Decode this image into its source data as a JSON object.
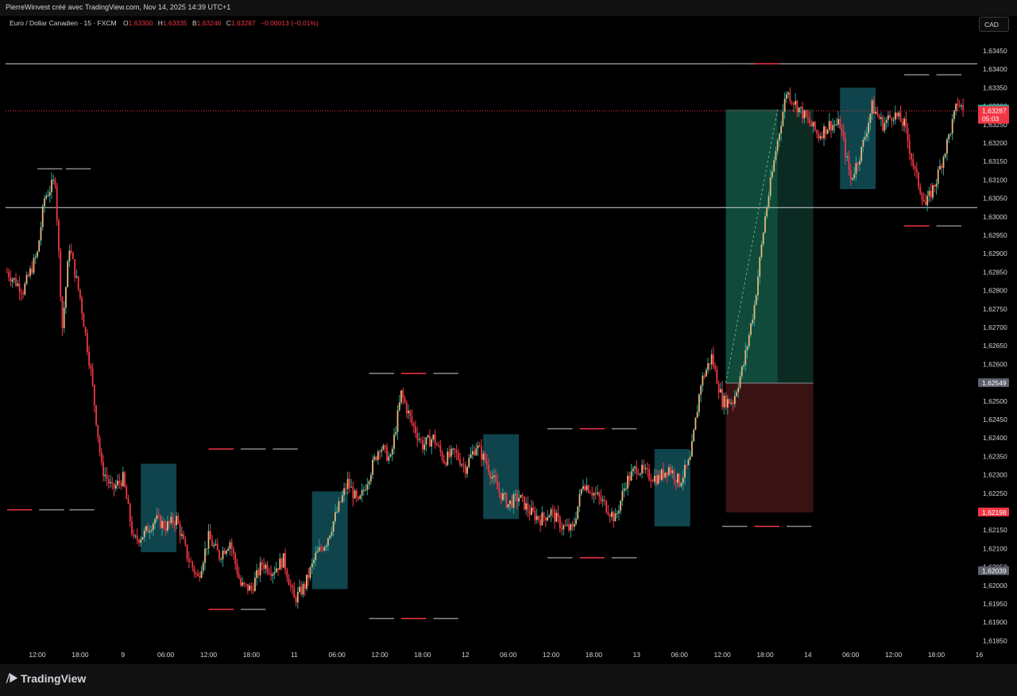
{
  "header": {
    "credit": "PierreWinvest créé avec TradingView.com, Nov 14, 2025 14:39 UTC+1",
    "currency_button": "CAD"
  },
  "legend": {
    "symbol": "Euro / Dollar Canadien · 15 · FXCM",
    "open_label": "O",
    "open": "1,63300",
    "high_label": "H",
    "high": "1,63335",
    "low_label": "B",
    "low": "1,63246",
    "close_label": "C",
    "close": "1,63287",
    "change": "−0,00013 (−0,01%)"
  },
  "footer": {
    "brand": "TradingView"
  },
  "colors": {
    "up": "#26a69a",
    "down": "#f23645",
    "candle_up": "#e8b77b",
    "fvg_box": "#14555f",
    "target_zone": "#0f4a3a",
    "stop_zone": "#3a1214"
  },
  "chart_data": {
    "type": "candlestick",
    "symbol": "Euro / Dollar Canadien",
    "interval": "15",
    "ylim": [
      1.6183,
      1.635
    ],
    "y_ticks": [
      "1,63450",
      "1,63400",
      "1,63350",
      "1,63300",
      "1,63250",
      "1,63200",
      "1,63150",
      "1,63100",
      "1,63050",
      "1,63000",
      "1,62950",
      "1,62900",
      "1,62850",
      "1,62800",
      "1,62750",
      "1,62700",
      "1,62650",
      "1,62600",
      "1,62550",
      "1,62500",
      "1,62450",
      "1,62400",
      "1,62350",
      "1,62300",
      "1,62250",
      "1,62200",
      "1,62150",
      "1,62100",
      "1,62050",
      "1,62000",
      "1,61950",
      "1,61900",
      "1,61850"
    ],
    "x_ticks": [
      {
        "label": "12:00",
        "i": 0
      },
      {
        "label": "18:00",
        "i": 24
      },
      {
        "label": "9",
        "i": 48
      },
      {
        "label": "06:00",
        "i": 72
      },
      {
        "label": "12:00",
        "i": 96
      },
      {
        "label": "18:00",
        "i": 120
      },
      {
        "label": "11",
        "i": 144
      },
      {
        "label": "06:00",
        "i": 168
      },
      {
        "label": "12:00",
        "i": 192
      },
      {
        "label": "18:00",
        "i": 216
      },
      {
        "label": "12",
        "i": 240
      },
      {
        "label": "06:00",
        "i": 264
      },
      {
        "label": "12:00",
        "i": 288
      },
      {
        "label": "18:00",
        "i": 312
      },
      {
        "label": "13",
        "i": 336
      },
      {
        "label": "06:00",
        "i": 360
      },
      {
        "label": "12:00",
        "i": 384
      },
      {
        "label": "18:00",
        "i": 408
      },
      {
        "label": "14",
        "i": 432
      },
      {
        "label": "06:00",
        "i": 456
      },
      {
        "label": "12:00",
        "i": 480
      },
      {
        "label": "18:00",
        "i": 504
      },
      {
        "label": "16",
        "i": 528
      }
    ],
    "price_path": [
      [
        -17,
        1.6285
      ],
      [
        -8,
        1.628
      ],
      [
        0,
        1.629
      ],
      [
        4,
        1.6305
      ],
      [
        10,
        1.631
      ],
      [
        14,
        1.627
      ],
      [
        18,
        1.6292
      ],
      [
        24,
        1.6278
      ],
      [
        30,
        1.6258
      ],
      [
        36,
        1.6232
      ],
      [
        42,
        1.6226
      ],
      [
        48,
        1.6229
      ],
      [
        54,
        1.6212
      ],
      [
        60,
        1.6214
      ],
      [
        66,
        1.6218
      ],
      [
        72,
        1.6216
      ],
      [
        78,
        1.6218
      ],
      [
        84,
        1.6208
      ],
      [
        90,
        1.6202
      ],
      [
        96,
        1.6213
      ],
      [
        102,
        1.6208
      ],
      [
        108,
        1.6212
      ],
      [
        114,
        1.62
      ],
      [
        120,
        1.6199
      ],
      [
        126,
        1.6206
      ],
      [
        132,
        1.6204
      ],
      [
        138,
        1.6207
      ],
      [
        144,
        1.6196
      ],
      [
        150,
        1.62
      ],
      [
        156,
        1.6208
      ],
      [
        162,
        1.6212
      ],
      [
        168,
        1.622
      ],
      [
        174,
        1.6228
      ],
      [
        180,
        1.6222
      ],
      [
        186,
        1.623
      ],
      [
        192,
        1.6238
      ],
      [
        198,
        1.6234
      ],
      [
        204,
        1.6252
      ],
      [
        210,
        1.6244
      ],
      [
        216,
        1.6238
      ],
      [
        222,
        1.624
      ],
      [
        228,
        1.6234
      ],
      [
        234,
        1.6236
      ],
      [
        240,
        1.6232
      ],
      [
        246,
        1.6238
      ],
      [
        252,
        1.6233
      ],
      [
        258,
        1.6226
      ],
      [
        264,
        1.6222
      ],
      [
        270,
        1.6224
      ],
      [
        276,
        1.622
      ],
      [
        282,
        1.6218
      ],
      [
        288,
        1.622
      ],
      [
        294,
        1.6216
      ],
      [
        300,
        1.6215
      ],
      [
        306,
        1.6228
      ],
      [
        312,
        1.6225
      ],
      [
        318,
        1.6222
      ],
      [
        324,
        1.6218
      ],
      [
        330,
        1.6228
      ],
      [
        336,
        1.6232
      ],
      [
        342,
        1.623
      ],
      [
        348,
        1.6229
      ],
      [
        354,
        1.6232
      ],
      [
        360,
        1.6228
      ],
      [
        366,
        1.6234
      ],
      [
        372,
        1.6255
      ],
      [
        378,
        1.6262
      ],
      [
        384,
        1.625
      ],
      [
        390,
        1.625
      ],
      [
        396,
        1.626
      ],
      [
        402,
        1.6276
      ],
      [
        408,
        1.63
      ],
      [
        414,
        1.6318
      ],
      [
        420,
        1.6334
      ],
      [
        426,
        1.633
      ],
      [
        432,
        1.6326
      ],
      [
        438,
        1.6322
      ],
      [
        444,
        1.6325
      ],
      [
        450,
        1.6325
      ],
      [
        456,
        1.631
      ],
      [
        462,
        1.6318
      ],
      [
        468,
        1.633
      ],
      [
        474,
        1.6325
      ],
      [
        480,
        1.6328
      ],
      [
        486,
        1.6325
      ],
      [
        492,
        1.6312
      ],
      [
        498,
        1.6303
      ],
      [
        504,
        1.631
      ],
      [
        510,
        1.632
      ],
      [
        516,
        1.6331
      ],
      [
        519,
        1.6329
      ]
    ],
    "horizontal_levels": [
      {
        "price": 1.63415,
        "style": "solid"
      },
      {
        "price": 1.63025,
        "style": "solid"
      },
      {
        "price": 1.63287,
        "style": "dotted"
      }
    ],
    "short_markers": [
      {
        "i0": 0,
        "i1": 14,
        "price": 1.6313
      },
      {
        "i0": 16,
        "i1": 30,
        "price": 1.6313
      },
      {
        "i0": -17,
        "i1": -3,
        "price": 1.62205
      },
      {
        "i0": 1,
        "i1": 15,
        "price": 1.62205
      },
      {
        "i0": 18,
        "i1": 32,
        "price": 1.62205
      },
      {
        "i0": 96,
        "i1": 110,
        "price": 1.6237
      },
      {
        "i0": 114,
        "i1": 128,
        "price": 1.6237
      },
      {
        "i0": 132,
        "i1": 146,
        "price": 1.6237
      },
      {
        "i0": 96,
        "i1": 110,
        "price": 1.61935
      },
      {
        "i0": 114,
        "i1": 128,
        "price": 1.61935
      },
      {
        "i0": 186,
        "i1": 200,
        "price": 1.62575
      },
      {
        "i0": 204,
        "i1": 218,
        "price": 1.62575
      },
      {
        "i0": 222,
        "i1": 236,
        "price": 1.62575
      },
      {
        "i0": 186,
        "i1": 200,
        "price": 1.6191
      },
      {
        "i0": 204,
        "i1": 218,
        "price": 1.6191
      },
      {
        "i0": 222,
        "i1": 236,
        "price": 1.6191
      },
      {
        "i0": 286,
        "i1": 300,
        "price": 1.62425
      },
      {
        "i0": 304,
        "i1": 318,
        "price": 1.62425
      },
      {
        "i0": 322,
        "i1": 336,
        "price": 1.62425
      },
      {
        "i0": 286,
        "i1": 300,
        "price": 1.62075
      },
      {
        "i0": 304,
        "i1": 318,
        "price": 1.62075
      },
      {
        "i0": 322,
        "i1": 336,
        "price": 1.62075
      },
      {
        "i0": 384,
        "i1": 398,
        "price": 1.6216
      },
      {
        "i0": 402,
        "i1": 416,
        "price": 1.6216
      },
      {
        "i0": 420,
        "i1": 434,
        "price": 1.6216
      },
      {
        "i0": 384,
        "i1": 398,
        "price": 1.63415
      },
      {
        "i0": 402,
        "i1": 416,
        "price": 1.63415
      },
      {
        "i0": 486,
        "i1": 500,
        "price": 1.63385
      },
      {
        "i0": 504,
        "i1": 518,
        "price": 1.63385
      },
      {
        "i0": 486,
        "i1": 500,
        "price": 1.62975
      },
      {
        "i0": 504,
        "i1": 518,
        "price": 1.62975
      }
    ],
    "fvg_boxes": [
      {
        "i0": 58,
        "i1": 78,
        "top": 1.6233,
        "bottom": 1.6209
      },
      {
        "i0": 154,
        "i1": 174,
        "top": 1.62255,
        "bottom": 1.6199
      },
      {
        "i0": 250,
        "i1": 270,
        "top": 1.6241,
        "bottom": 1.6218
      },
      {
        "i0": 346,
        "i1": 366,
        "top": 1.6237,
        "bottom": 1.6216
      },
      {
        "i0": 450,
        "i1": 470,
        "top": 1.6335,
        "bottom": 1.63075
      }
    ],
    "position": {
      "i0": 386,
      "i1": 435,
      "entry": 1.62549,
      "target": 1.63291,
      "stop": 1.62198,
      "filled_to": 1.63291,
      "filled_i1": 415
    },
    "price_labels": [
      {
        "text": "1,63291",
        "price": 1.63291,
        "bg": "#26a69a",
        "fg": "#ffffff"
      },
      {
        "text": "1,63287",
        "sub": "05:03",
        "price": 1.63287,
        "bg": "#f23645",
        "fg": "#ffffff"
      },
      {
        "text": "1,62549",
        "price": 1.62549,
        "bg": "#5d606b",
        "fg": "#ffffff"
      },
      {
        "text": "1,62198",
        "price": 1.62198,
        "bg": "#f23645",
        "fg": "#ffffff"
      },
      {
        "text": "1,62039",
        "price": 1.62039,
        "bg": "#5d606b",
        "fg": "#ffffff"
      }
    ]
  }
}
